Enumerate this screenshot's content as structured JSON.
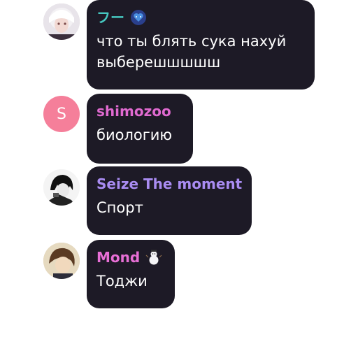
{
  "messages": [
    {
      "author": "フー",
      "author_color": "#46c7c0",
      "badge": "blue-heart-sticker-icon",
      "lines": [
        "что ты блять сука нахуй",
        "выберешшшшш"
      ]
    },
    {
      "author": "shimozoo",
      "author_color": "#e06ad0",
      "avatar_letter": "S",
      "avatar_color": "#f57f9a",
      "lines": [
        "биологию"
      ]
    },
    {
      "author": "Seize The moment",
      "author_color": "#a98cf2",
      "lines": [
        "Спорт"
      ]
    },
    {
      "author": "Mond",
      "author_color": "#e86fd6",
      "badge": "snowman-icon",
      "lines": [
        "Тоджи"
      ]
    }
  ]
}
